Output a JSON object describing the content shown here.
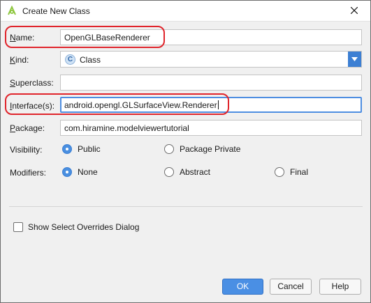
{
  "window": {
    "title": "Create New Class",
    "close_glyph": "✕"
  },
  "fields": {
    "name": {
      "label": "Name:",
      "value": "OpenGLBaseRenderer"
    },
    "kind": {
      "label": "Kind:",
      "value": "Class",
      "icon_letter": "C"
    },
    "superclass": {
      "label": "Superclass:",
      "value": ""
    },
    "interfaces": {
      "label": "Interface(s):",
      "value": "android.opengl.GLSurfaceView.Renderer"
    },
    "package": {
      "label": "Package:",
      "value": "com.hiramine.modelviewertutorial"
    }
  },
  "visibility": {
    "label": "Visibility:",
    "options": [
      {
        "label": "Public",
        "checked": true
      },
      {
        "label": "Package Private",
        "checked": false
      }
    ]
  },
  "modifiers": {
    "label": "Modifiers:",
    "options": [
      {
        "label": "None",
        "checked": true
      },
      {
        "label": "Abstract",
        "checked": false
      },
      {
        "label": "Final",
        "checked": false
      }
    ]
  },
  "show_overrides": {
    "label": "Show Select Overrides Dialog",
    "checked": false
  },
  "buttons": {
    "ok": "OK",
    "cancel": "Cancel",
    "help": "Help"
  },
  "colors": {
    "accent": "#4a8fe4",
    "highlight": "#e0242b",
    "android_green": "#8ec63f"
  }
}
